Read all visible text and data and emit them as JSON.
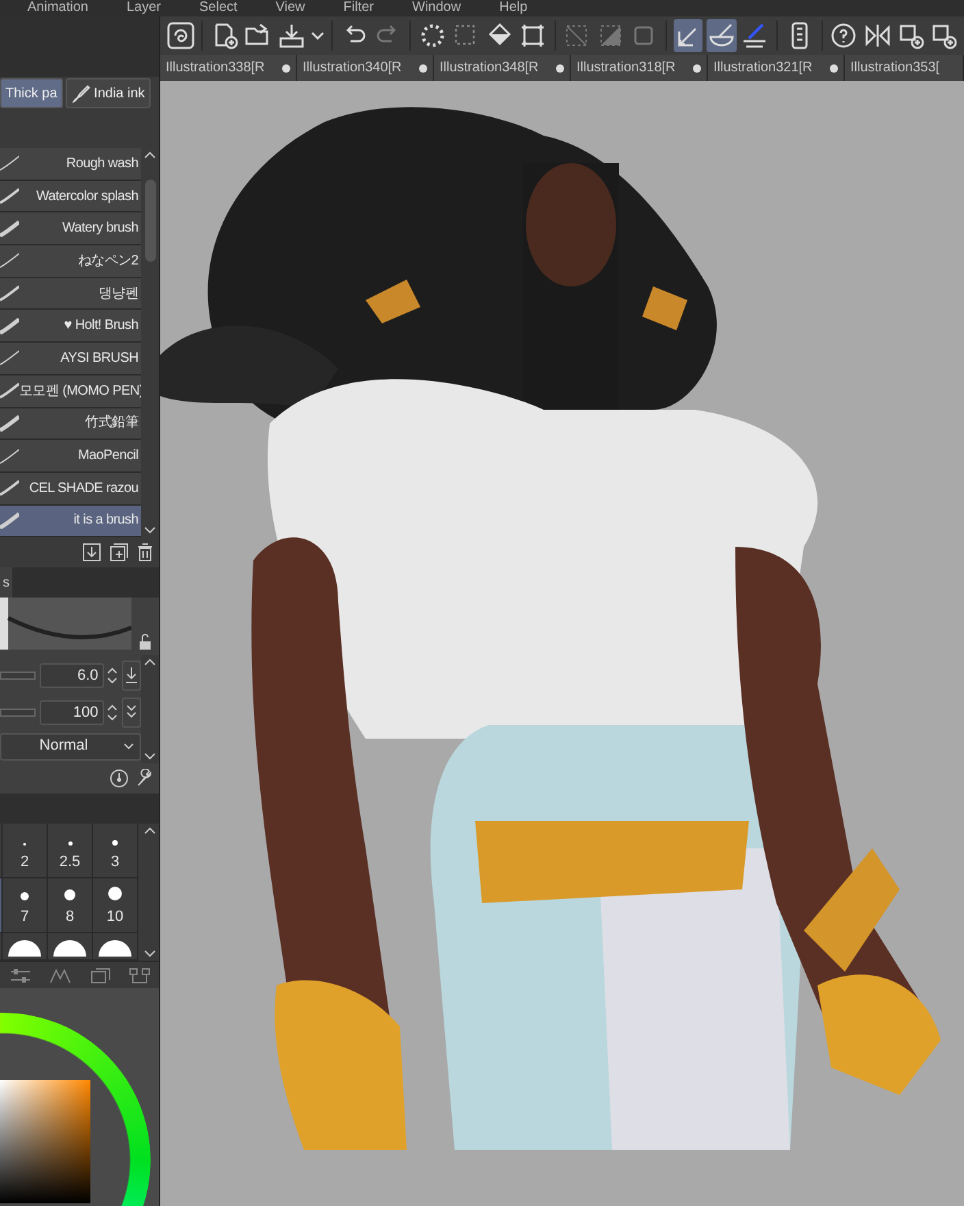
{
  "menu": [
    "Animation",
    "Layer",
    "Select",
    "View",
    "Filter",
    "Window",
    "Help"
  ],
  "toolbar": [
    {
      "selected": false
    },
    {
      "selected": false
    },
    {
      "selected": false
    },
    {
      "selected": false
    },
    {
      "selected": false
    },
    {
      "selected": false
    },
    {
      "selected": false
    },
    {
      "selected": false
    },
    {
      "selected": false
    },
    {
      "selected": false
    },
    {
      "selected": false
    },
    {
      "selected": false
    },
    {
      "selected": false
    },
    {
      "selected": false
    },
    {
      "selected": true
    },
    {
      "selected": true
    },
    {
      "selected": false
    },
    {
      "selected": false
    },
    {
      "selected": false
    },
    {
      "selected": false
    },
    {
      "selected": false
    },
    {
      "selected": false
    }
  ],
  "document_tabs": [
    {
      "label": "Illustration338[R",
      "modified": true
    },
    {
      "label": "Illustration340[R",
      "modified": true
    },
    {
      "label": "Illustration348[R",
      "modified": true
    },
    {
      "label": "Illustration318[R",
      "modified": true
    },
    {
      "label": "Illustration321[R",
      "modified": true
    },
    {
      "label": "Illustration353[",
      "modified": false
    }
  ],
  "tool_tabs": [
    {
      "label": "Thick pa",
      "selected": true
    },
    {
      "label": "India ink",
      "selected": false
    }
  ],
  "brushes": [
    {
      "label": "Rough wash",
      "selected": false
    },
    {
      "label": "Watercolor splash",
      "selected": false
    },
    {
      "label": "Watery brush",
      "selected": false
    },
    {
      "label": "ねなペン2",
      "selected": false
    },
    {
      "label": "댕냥펜",
      "selected": false
    },
    {
      "label": "♥ Holt! Brush",
      "selected": false
    },
    {
      "label": "AYSI BRUSH",
      "selected": false
    },
    {
      "label": "모모펜 (MOMO PEN)",
      "selected": false
    },
    {
      "label": "竹式鉛筆",
      "selected": false
    },
    {
      "label": "MaoPencil",
      "selected": false
    },
    {
      "label": "CEL SHADE razou",
      "selected": false
    },
    {
      "label": "it is a brush",
      "selected": true
    }
  ],
  "properties": {
    "tab": "s",
    "size": "6.0",
    "opacity": "100",
    "blend_mode": "Normal"
  },
  "brush_sizes": [
    [
      {
        "selected": false
      },
      {
        "label": "2",
        "selected": false
      },
      {
        "label": "2.5",
        "selected": false
      },
      {
        "label": "3",
        "selected": false
      }
    ],
    [
      {
        "selected": true
      },
      {
        "label": "7",
        "selected": false
      },
      {
        "label": "8",
        "selected": false
      },
      {
        "label": "10",
        "selected": false
      }
    ],
    [
      {
        "selected": false
      },
      {
        "selected": false
      },
      {
        "selected": false
      },
      {
        "selected": false
      }
    ]
  ]
}
